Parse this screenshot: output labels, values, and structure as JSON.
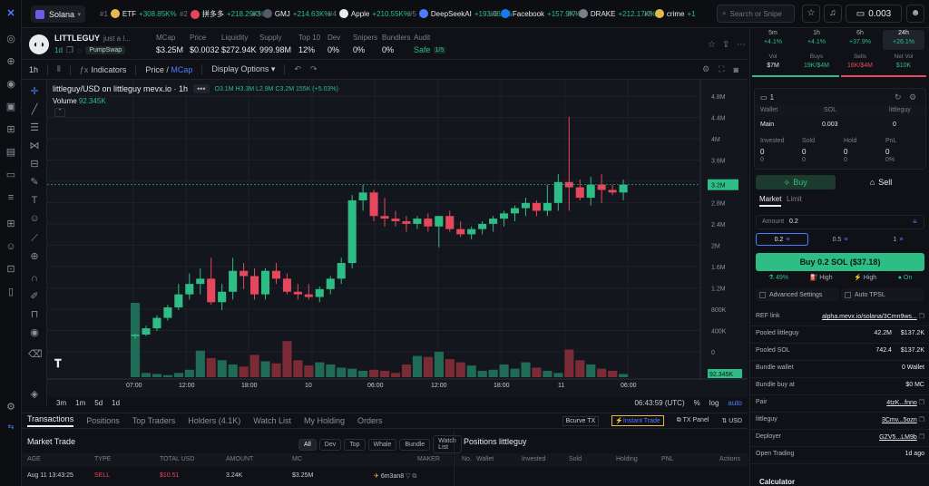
{
  "chain": {
    "name": "Solana"
  },
  "ticker": [
    {
      "rank": "#1",
      "name": "ETF",
      "change": "+308.85K%",
      "color": "#e5b94d"
    },
    {
      "rank": "#2",
      "name": "拼多多",
      "change": "+218.29K%",
      "color": "#e5485d"
    },
    {
      "rank": "#3",
      "name": "GMJ",
      "change": "+214.63K%",
      "color": "#555b66"
    },
    {
      "rank": "#4",
      "name": "Apple",
      "change": "+210.55K%",
      "color": "#e9ebef"
    },
    {
      "rank": "#5",
      "name": "DeepSeekAI",
      "change": "+193.06K%",
      "color": "#4d7cfe"
    },
    {
      "rank": "#6",
      "name": "Facebook",
      "change": "+157.9K%",
      "color": "#1877f2"
    },
    {
      "rank": "#7",
      "name": "DRAKE",
      "change": "+212.17K%",
      "color": "#7a7f8a"
    },
    {
      "rank": "#8",
      "name": "crime",
      "change": "+1",
      "color": "#e5b94d"
    }
  ],
  "search": {
    "placeholder": "Search or Snipe"
  },
  "wallet": {
    "balance": "0.003"
  },
  "token": {
    "name": "LITTLEGUY",
    "desc": "just a l...",
    "age": "1d",
    "pool": "PumpSwap",
    "mcap_label": "MCap",
    "mcap": "$3.25M",
    "price_label": "Price",
    "price": "$0.0032",
    "liq_label": "Liquidity",
    "liq": "$272.94K",
    "supply_label": "Supply",
    "supply": "999.98M",
    "top10_label": "Top 10",
    "top10": "12%",
    "dev_label": "Dev",
    "dev": "0%",
    "snipers_label": "Snipers",
    "snipers": "0%",
    "bundlers_label": "Bundlers",
    "bundlers": "0%",
    "audit_label": "Audit",
    "audit": "Safe",
    "audit_score": "1/5"
  },
  "charttool": {
    "interval": "1h",
    "indicators": "Indicators",
    "price_label": "Price",
    "mcap_label": "MCap",
    "display": "Display Options"
  },
  "chart": {
    "symbol": "littleguy/USD on littleguy mevx.io · 1h",
    "o": "3.1M",
    "h": "3.3M",
    "l": "2.9M",
    "c": "3.2M",
    "chg": "155K (+5.03%)",
    "volume_label": "Volume",
    "volume": "92.345K",
    "last_price_label": "3.2M",
    "last_vol_label": "92.345K",
    "yticks": [
      "4.8M",
      "4.4M",
      "4M",
      "3.6M",
      "3.2M",
      "2.8M",
      "2.4M",
      "2M",
      "1.6M",
      "1.2M",
      "800K",
      "400K",
      "0"
    ],
    "xticks": [
      "07:00",
      "12:00",
      "18:00",
      "10",
      "06:00",
      "12:00",
      "18:00",
      "11",
      "06:00"
    ],
    "clock": "06:43:59 (UTC)",
    "pct": "%",
    "log": "log",
    "auto": "auto"
  },
  "chart_data": {
    "type": "candlestick",
    "y_unit": "MCap USD",
    "candles": [
      [
        0.3,
        0.35,
        0.25,
        0.33
      ],
      [
        0.33,
        0.5,
        0.3,
        0.45
      ],
      [
        0.45,
        0.7,
        0.4,
        0.65
      ],
      [
        0.65,
        0.9,
        0.6,
        0.85
      ],
      [
        0.85,
        1.3,
        0.8,
        1.1
      ],
      [
        1.1,
        1.5,
        1.0,
        1.3
      ],
      [
        1.3,
        1.6,
        1.1,
        1.4
      ],
      [
        1.4,
        1.8,
        0.9,
        0.95
      ],
      [
        0.95,
        1.3,
        0.8,
        1.15
      ],
      [
        1.15,
        1.8,
        1.0,
        1.55
      ],
      [
        1.55,
        1.7,
        1.2,
        1.45
      ],
      [
        1.45,
        1.6,
        1.0,
        1.1
      ],
      [
        1.1,
        1.6,
        1.0,
        1.55
      ],
      [
        1.55,
        1.7,
        1.3,
        1.4
      ],
      [
        1.4,
        1.5,
        1.1,
        1.15
      ],
      [
        1.15,
        1.3,
        1.0,
        1.1
      ],
      [
        1.1,
        1.3,
        1.0,
        1.05
      ],
      [
        1.05,
        1.25,
        0.95,
        1.2
      ],
      [
        1.2,
        1.45,
        1.1,
        1.4
      ],
      [
        1.4,
        1.8,
        1.3,
        1.7
      ],
      [
        1.7,
        3.0,
        1.6,
        2.9
      ],
      [
        2.9,
        3.2,
        2.7,
        3.05
      ],
      [
        3.05,
        3.1,
        2.5,
        2.6
      ],
      [
        2.6,
        2.95,
        2.4,
        2.55
      ],
      [
        2.55,
        2.7,
        2.4,
        2.5
      ],
      [
        2.5,
        2.6,
        2.3,
        2.45
      ],
      [
        2.45,
        2.6,
        2.35,
        2.55
      ],
      [
        2.55,
        2.65,
        2.3,
        2.4
      ],
      [
        2.4,
        2.6,
        2.0,
        2.6
      ],
      [
        2.6,
        2.7,
        2.3,
        2.35
      ],
      [
        2.35,
        2.5,
        2.2,
        2.25
      ],
      [
        2.25,
        2.4,
        2.15,
        2.35
      ],
      [
        2.35,
        2.5,
        2.25,
        2.45
      ],
      [
        2.45,
        2.6,
        2.3,
        2.55
      ],
      [
        2.55,
        2.7,
        2.4,
        2.65
      ],
      [
        2.65,
        2.8,
        2.5,
        2.75
      ],
      [
        2.75,
        2.95,
        2.6,
        2.85
      ],
      [
        2.85,
        2.9,
        2.6,
        2.7
      ],
      [
        2.7,
        3.2,
        2.6,
        2.85
      ],
      [
        2.85,
        3.4,
        2.7,
        3.25
      ],
      [
        3.25,
        4.5,
        2.7,
        3.15
      ],
      [
        3.15,
        3.3,
        2.9,
        2.95
      ],
      [
        2.95,
        3.35,
        2.8,
        3.2
      ],
      [
        3.2,
        3.4,
        2.85,
        3.1
      ],
      [
        3.1,
        3.2,
        3.0,
        3.05
      ],
      [
        3.05,
        3.3,
        2.9,
        3.2
      ]
    ],
    "volumes": [
      700,
      40,
      30,
      20,
      40,
      70,
      250,
      180,
      160,
      120,
      100,
      210,
      150,
      130,
      340,
      160,
      110,
      140,
      120,
      90,
      80,
      60,
      70,
      60,
      40,
      120,
      200,
      190,
      240,
      170,
      140,
      110,
      60,
      70,
      120,
      80,
      140,
      90,
      60,
      40,
      260,
      160,
      120,
      80,
      60,
      30
    ],
    "ylim": [
      0,
      5
    ]
  },
  "timeframes": [
    "3m",
    "1m",
    "5d",
    "1d"
  ],
  "tabs": [
    "Transactions",
    "Positions",
    "Top Traders",
    "Holders (4.1K)",
    "Watch List",
    "My Holding",
    "Orders"
  ],
  "tabtools": {
    "bcurve": "Bcurve TX",
    "instant": "Instant Trade",
    "tx_panel": "TX Panel",
    "usd": "USD"
  },
  "trades": {
    "title": "Market Trade",
    "filters": [
      "All",
      "Dev",
      "Top",
      "Whale",
      "Bundle",
      "Watch List"
    ],
    "headers": [
      "AGE",
      "TYPE",
      "TOTAL USD",
      "AMOUNT",
      "MC",
      "MAKER"
    ],
    "row": [
      "Aug 11 13:43:25",
      "SELL",
      "$10.51",
      "3.24K",
      "$3.25M",
      "6m3an8"
    ]
  },
  "positions": {
    "title": "Positions littleguy",
    "headers": [
      "No.",
      "Wallet",
      "Invested",
      "Sold",
      "Holding",
      "PNL",
      "Actions"
    ]
  },
  "right": {
    "tfs": [
      {
        "l": "5m",
        "c": "+4.1%"
      },
      {
        "l": "1h",
        "c": "+4.1%"
      },
      {
        "l": "6h",
        "c": "+37.9%"
      },
      {
        "l": "24h",
        "c": "+26.1%"
      }
    ],
    "mini": [
      {
        "l": "Vol",
        "v": "$7M"
      },
      {
        "l": "Buys",
        "v": "19K/$4M"
      },
      {
        "l": "Sells",
        "v": "16K/$4M"
      },
      {
        "l": "Net Vol",
        "v": "$10K"
      }
    ],
    "wallet_count": "1",
    "wallet_hdr": [
      "Wallet",
      "SOL",
      "littleguy"
    ],
    "main": {
      "name": "Main",
      "sol": "0.003",
      "lg": "0"
    },
    "pnl_hdr": [
      "Invested",
      "Sold",
      "Hold",
      "PnL"
    ],
    "pnl_vals": [
      "0",
      "0",
      "0",
      "0"
    ],
    "pnl_sub": [
      "0",
      "0",
      "0",
      "0%"
    ],
    "buy": "Buy",
    "sell": "Sell",
    "market": "Market",
    "limit": "Limit",
    "amount_label": "Amount",
    "amount": "0.2",
    "presets": [
      "0.2",
      "0.5",
      "1"
    ],
    "buy_btn": "Buy 0.2 SOL ($37.18)",
    "opts": [
      "49%",
      "High",
      "High",
      "On"
    ],
    "adv": "Advanced Settings",
    "tpsl": "Auto TPSL",
    "info": [
      {
        "k": "REF link",
        "v": "alpha.mevx.io/solana/3Cmn9ws..."
      },
      {
        "k": "Pooled littleguy",
        "v": "42.2M",
        "v2": "$137.2K"
      },
      {
        "k": "Pooled SOL",
        "v": "742.4",
        "v2": "$137.2K"
      },
      {
        "k": "Bundle wallet",
        "v": "0 Wallet"
      },
      {
        "k": "Bundle buy at",
        "v": "$0 MC"
      },
      {
        "k": "Pair",
        "v": "4tzK...fnno"
      },
      {
        "k": "littleguy",
        "v": "3Cmv...5ozn"
      },
      {
        "k": "Deployer",
        "v": "GZV5...LM9b"
      },
      {
        "k": "Open Trading",
        "v": "1d ago"
      }
    ],
    "calculator": "Calculator"
  },
  "colors": {
    "up": "#2ebd85",
    "down": "#e5485d",
    "bg": "#0f1116",
    "chart": "#13161d"
  }
}
